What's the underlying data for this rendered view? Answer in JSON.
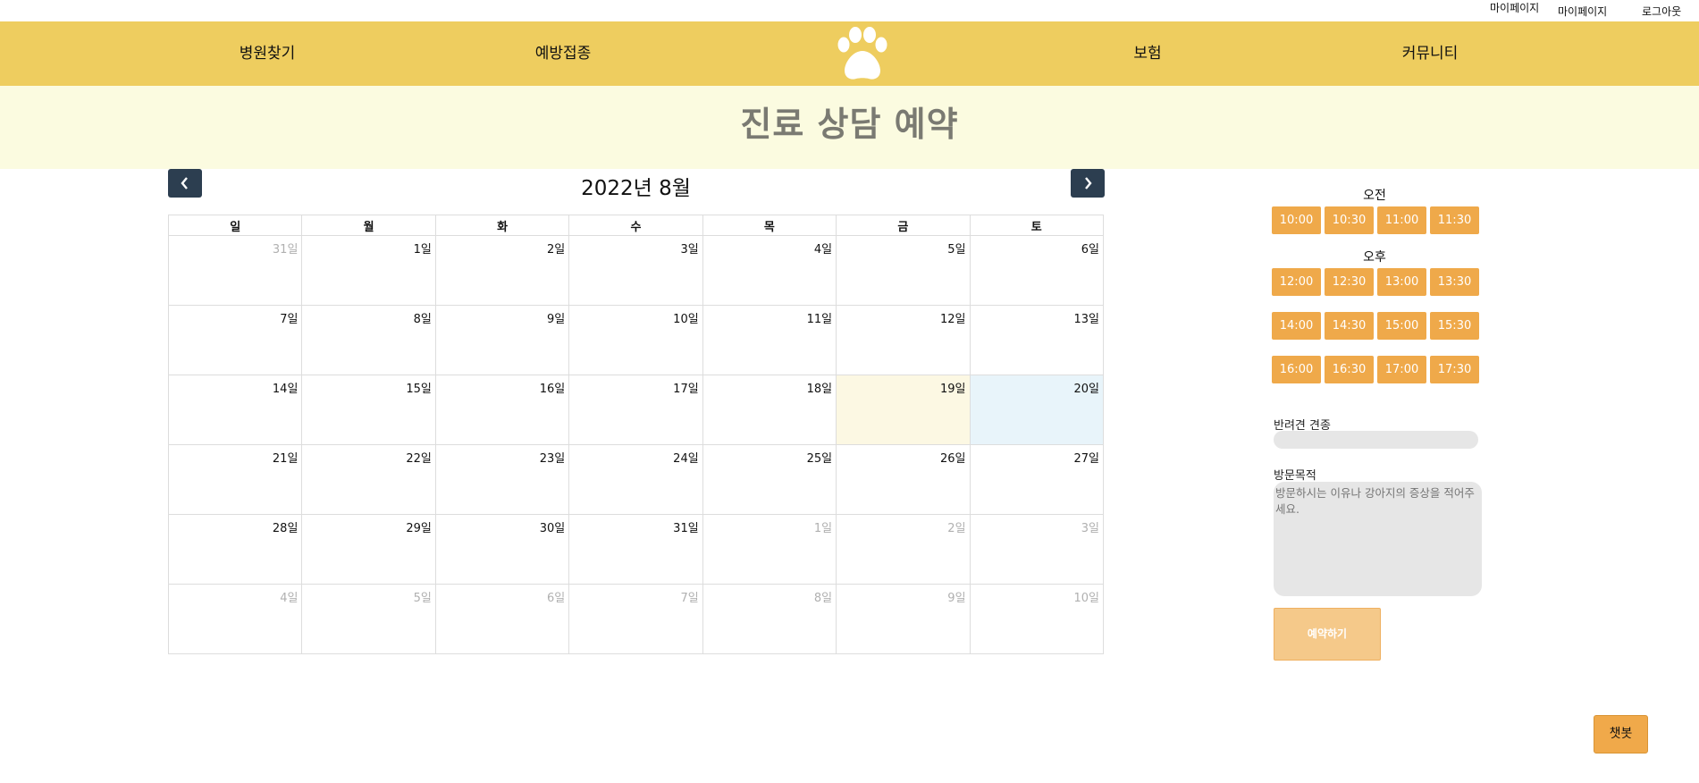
{
  "top_links": {
    "mypage_1": "마이페이지",
    "mypage_2": "마이페이지",
    "logout": "로그아웃"
  },
  "nav": {
    "items": [
      "병원찾기",
      "예방접종",
      "보험",
      "커뮤니티"
    ],
    "logo_icon": "paw-icon"
  },
  "banner": {
    "title": "진료 상담 예약"
  },
  "calendar": {
    "title": "2022년 8월",
    "prev_icon": "chevron-left-icon",
    "next_icon": "chevron-right-icon",
    "weekdays": [
      "일",
      "월",
      "화",
      "수",
      "목",
      "금",
      "토"
    ],
    "weeks": [
      [
        {
          "label": "31일",
          "other": true
        },
        {
          "label": "1일"
        },
        {
          "label": "2일"
        },
        {
          "label": "3일"
        },
        {
          "label": "4일"
        },
        {
          "label": "5일"
        },
        {
          "label": "6일"
        }
      ],
      [
        {
          "label": "7일"
        },
        {
          "label": "8일"
        },
        {
          "label": "9일"
        },
        {
          "label": "10일"
        },
        {
          "label": "11일"
        },
        {
          "label": "12일"
        },
        {
          "label": "13일"
        }
      ],
      [
        {
          "label": "14일"
        },
        {
          "label": "15일"
        },
        {
          "label": "16일"
        },
        {
          "label": "17일"
        },
        {
          "label": "18일"
        },
        {
          "label": "19일",
          "today": true
        },
        {
          "label": "20일",
          "selected": true
        }
      ],
      [
        {
          "label": "21일"
        },
        {
          "label": "22일"
        },
        {
          "label": "23일"
        },
        {
          "label": "24일"
        },
        {
          "label": "25일"
        },
        {
          "label": "26일"
        },
        {
          "label": "27일"
        }
      ],
      [
        {
          "label": "28일"
        },
        {
          "label": "29일"
        },
        {
          "label": "30일"
        },
        {
          "label": "31일"
        },
        {
          "label": "1일",
          "other": true
        },
        {
          "label": "2일",
          "other": true
        },
        {
          "label": "3일",
          "other": true
        }
      ],
      [
        {
          "label": "4일",
          "other": true
        },
        {
          "label": "5일",
          "other": true
        },
        {
          "label": "6일",
          "other": true
        },
        {
          "label": "7일",
          "other": true
        },
        {
          "label": "8일",
          "other": true
        },
        {
          "label": "9일",
          "other": true
        },
        {
          "label": "10일",
          "other": true
        }
      ]
    ]
  },
  "time_slots": {
    "am_label": "오전",
    "pm_label": "오후",
    "am": [
      "10:00",
      "10:30",
      "11:00",
      "11:30"
    ],
    "pm_rows": [
      [
        "12:00",
        "12:30",
        "13:00",
        "13:30"
      ],
      [
        "14:00",
        "14:30",
        "15:00",
        "15:30"
      ],
      [
        "16:00",
        "16:30",
        "17:00",
        "17:30"
      ]
    ]
  },
  "form": {
    "breed_label": "반려견 견종",
    "breed_value": "",
    "purpose_label": "방문목적",
    "purpose_placeholder": "방문하시는 이유나 강아지의 증상을 적어주세요.",
    "submit_label": "예약하기"
  },
  "chatbot": {
    "label": "챗봇"
  },
  "colors": {
    "nav_bg": "#eecd5f",
    "banner_bg": "#fbfbe0",
    "slot_bg": "#efa94a",
    "dark_btn": "#2c3e50",
    "today_bg": "#fcf8e3",
    "selected_bg": "#e8f4fa"
  }
}
